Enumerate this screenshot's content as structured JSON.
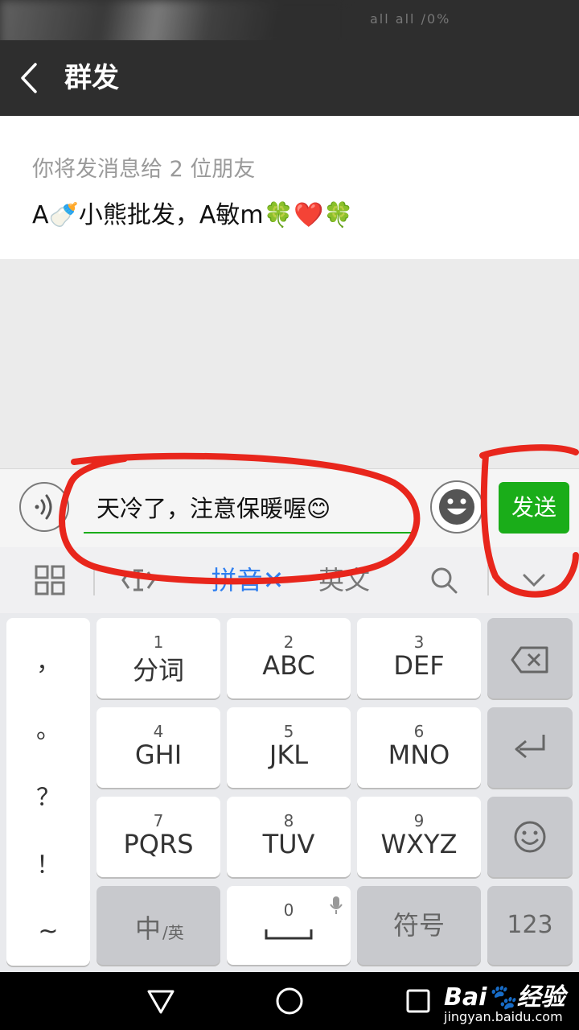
{
  "status_bar": {
    "text": "all all /0%"
  },
  "header": {
    "title": "群发"
  },
  "recipients": {
    "count_text": "你将发消息给 2 位朋友",
    "names": "A🍼小熊批发，A敏m🍀❤️🍀"
  },
  "composer": {
    "message": "天冷了，注意保暖喔😊",
    "send_label": "发送"
  },
  "ime_toolbar": {
    "pinyin_label": "拼音✕",
    "english_label": "英文"
  },
  "keyboard": {
    "punctuation": [
      "，",
      "。",
      "？",
      "！",
      "~"
    ],
    "keys": [
      {
        "num": "1",
        "label": "分词"
      },
      {
        "num": "2",
        "label": "ABC"
      },
      {
        "num": "3",
        "label": "DEF"
      },
      {
        "num": "4",
        "label": "GHI"
      },
      {
        "num": "5",
        "label": "JKL"
      },
      {
        "num": "6",
        "label": "MNO"
      },
      {
        "num": "7",
        "label": "PQRS"
      },
      {
        "num": "8",
        "label": "TUV"
      },
      {
        "num": "9",
        "label": "WXYZ"
      }
    ],
    "zh_en_main": "中",
    "zh_en_sub": "/英",
    "zero_num": "0",
    "symbols_label": "符号",
    "numbers_label": "123"
  },
  "watermark": {
    "main": "Bai🐾经验",
    "sub": "jingyan.baidu.com"
  },
  "colors": {
    "accent": "#1aad19",
    "header_bg": "#2e2e2e",
    "annotation": "#e8261c",
    "ime_active": "#2f7ff0"
  }
}
